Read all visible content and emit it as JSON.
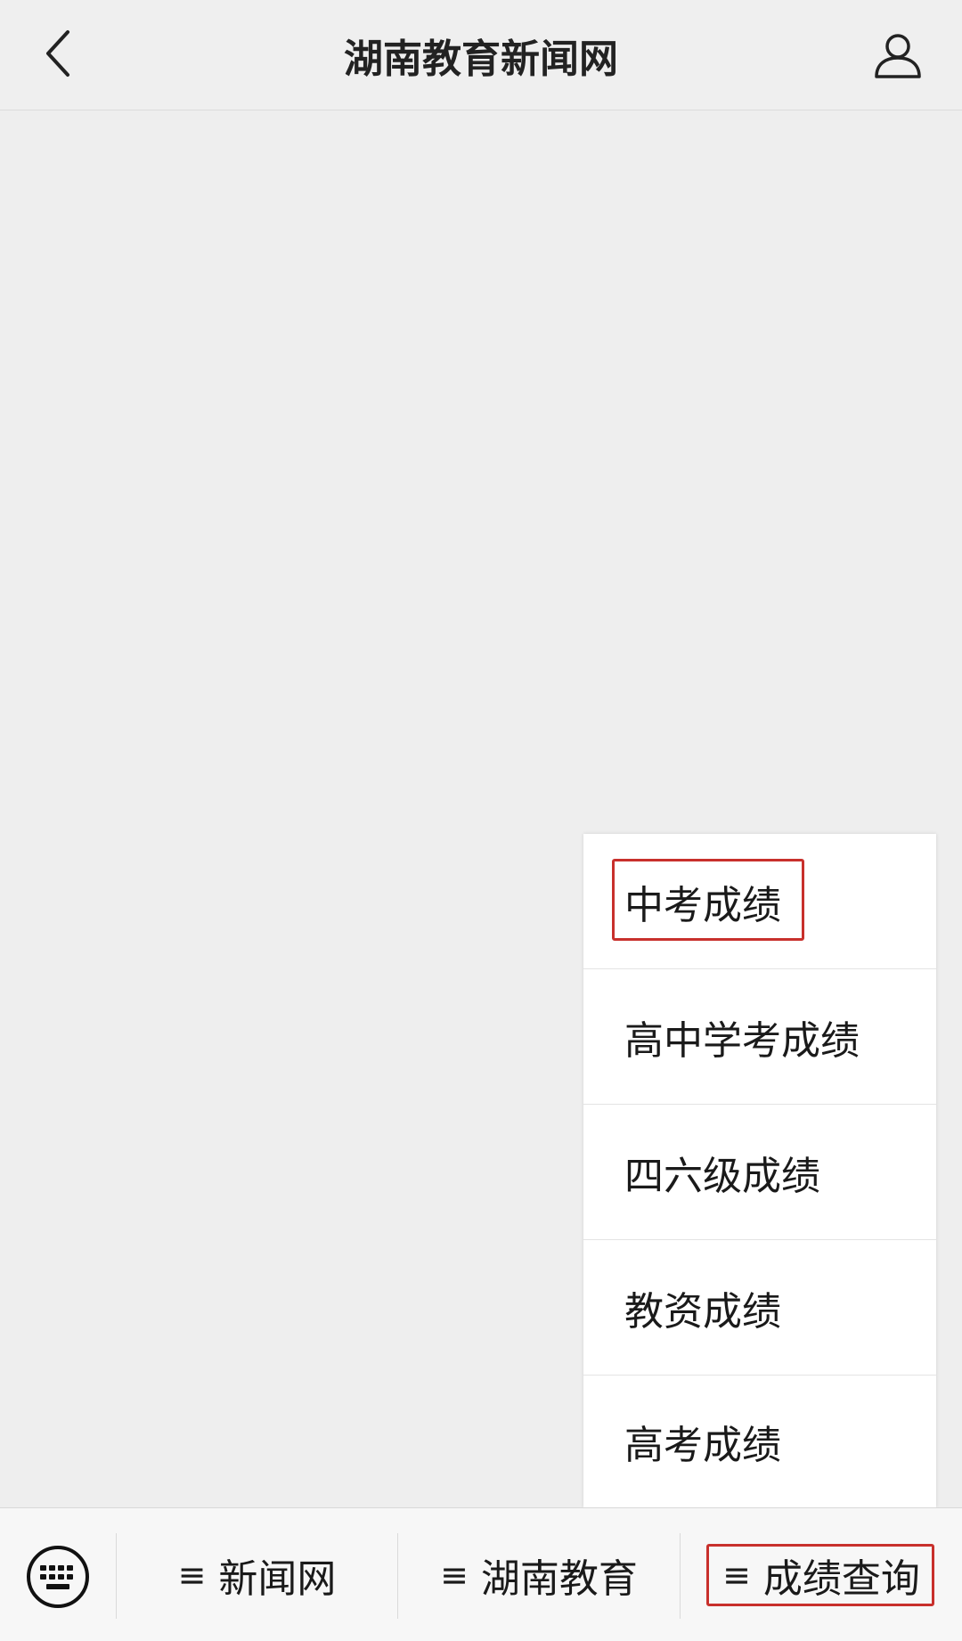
{
  "nav": {
    "title": "湖南教育新闻网",
    "back_icon": "chevron-left-icon",
    "profile_icon": "user-profile-icon"
  },
  "popup_menu": {
    "items": [
      {
        "label": "中考成绩",
        "highlighted": true
      },
      {
        "label": "高中学考成绩"
      },
      {
        "label": "四六级成绩"
      },
      {
        "label": "教资成绩"
      },
      {
        "label": "高考成绩"
      }
    ]
  },
  "bottom_bar": {
    "keyboard_icon": "keyboard-icon",
    "menu_glyph": "≡",
    "tabs": [
      {
        "label": "新闻网"
      },
      {
        "label": "湖南教育"
      },
      {
        "label": "成绩查询",
        "highlighted": true
      }
    ]
  },
  "colors": {
    "highlight": "#c8302c",
    "background": "#eeeeee",
    "menu_bg": "#ffffff",
    "text": "#1a1a1a"
  }
}
